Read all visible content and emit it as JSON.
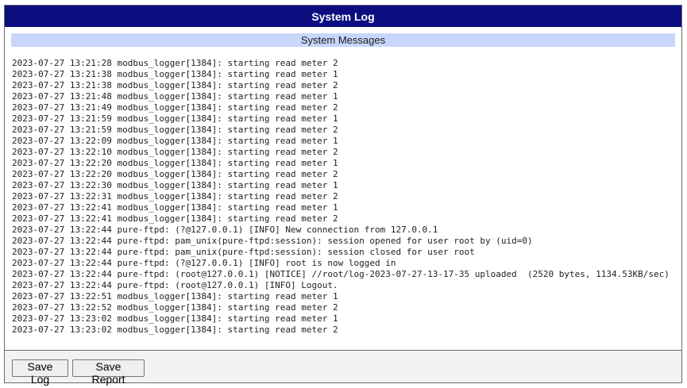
{
  "window": {
    "title": "System Log"
  },
  "section": {
    "title": "System Messages"
  },
  "log": {
    "lines": [
      "2023-07-27 13:21:28 modbus_logger[1384]: starting read meter 2",
      "2023-07-27 13:21:38 modbus_logger[1384]: starting read meter 1",
      "2023-07-27 13:21:38 modbus_logger[1384]: starting read meter 2",
      "2023-07-27 13:21:48 modbus_logger[1384]: starting read meter 1",
      "2023-07-27 13:21:49 modbus_logger[1384]: starting read meter 2",
      "2023-07-27 13:21:59 modbus_logger[1384]: starting read meter 1",
      "2023-07-27 13:21:59 modbus_logger[1384]: starting read meter 2",
      "2023-07-27 13:22:09 modbus_logger[1384]: starting read meter 1",
      "2023-07-27 13:22:10 modbus_logger[1384]: starting read meter 2",
      "2023-07-27 13:22:20 modbus_logger[1384]: starting read meter 1",
      "2023-07-27 13:22:20 modbus_logger[1384]: starting read meter 2",
      "2023-07-27 13:22:30 modbus_logger[1384]: starting read meter 1",
      "2023-07-27 13:22:31 modbus_logger[1384]: starting read meter 2",
      "2023-07-27 13:22:41 modbus_logger[1384]: starting read meter 1",
      "2023-07-27 13:22:41 modbus_logger[1384]: starting read meter 2",
      "2023-07-27 13:22:44 pure-ftpd: (?@127.0.0.1) [INFO] New connection from 127.0.0.1",
      "2023-07-27 13:22:44 pure-ftpd: pam_unix(pure-ftpd:session): session opened for user root by (uid=0)",
      "2023-07-27 13:22:44 pure-ftpd: pam_unix(pure-ftpd:session): session closed for user root",
      "2023-07-27 13:22:44 pure-ftpd: (?@127.0.0.1) [INFO] root is now logged in",
      "2023-07-27 13:22:44 pure-ftpd: (root@127.0.0.1) [NOTICE] //root/log-2023-07-27-13-17-35 uploaded  (2520 bytes, 1134.53KB/sec)",
      "2023-07-27 13:22:44 pure-ftpd: (root@127.0.0.1) [INFO] Logout.",
      "2023-07-27 13:22:51 modbus_logger[1384]: starting read meter 1",
      "2023-07-27 13:22:52 modbus_logger[1384]: starting read meter 2",
      "2023-07-27 13:23:02 modbus_logger[1384]: starting read meter 1",
      "2023-07-27 13:23:02 modbus_logger[1384]: starting read meter 2"
    ]
  },
  "actions": {
    "save_log": "Save Log",
    "save_report": "Save Report"
  }
}
